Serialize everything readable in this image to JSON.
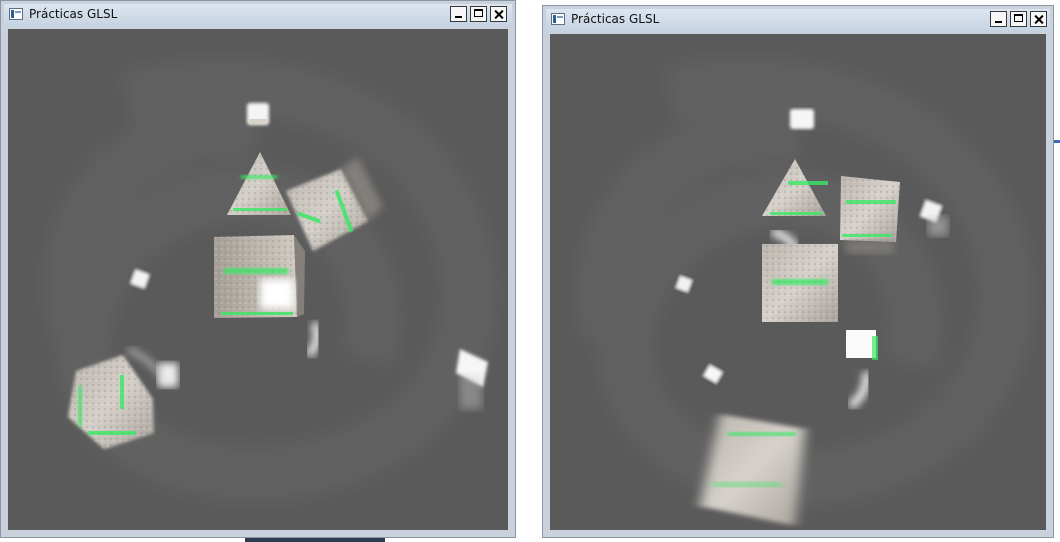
{
  "windows": [
    {
      "title": "Prácticas GLSL",
      "controls": {
        "minimize": "minimize",
        "maximize": "maximize",
        "close": "close"
      }
    },
    {
      "title": "Prácticas GLSL",
      "controls": {
        "minimize": "minimize",
        "maximize": "maximize",
        "close": "close"
      }
    }
  ],
  "colors": {
    "viewport_background": "#5a5a5a",
    "stone_texture": "#c8c2bb",
    "glow_green": "#39e864",
    "light_cube": "#ffffff",
    "titlebar": "#c6d3e2"
  },
  "icons": [
    "app-icon",
    "minimize-icon",
    "maximize-icon",
    "close-icon"
  ]
}
